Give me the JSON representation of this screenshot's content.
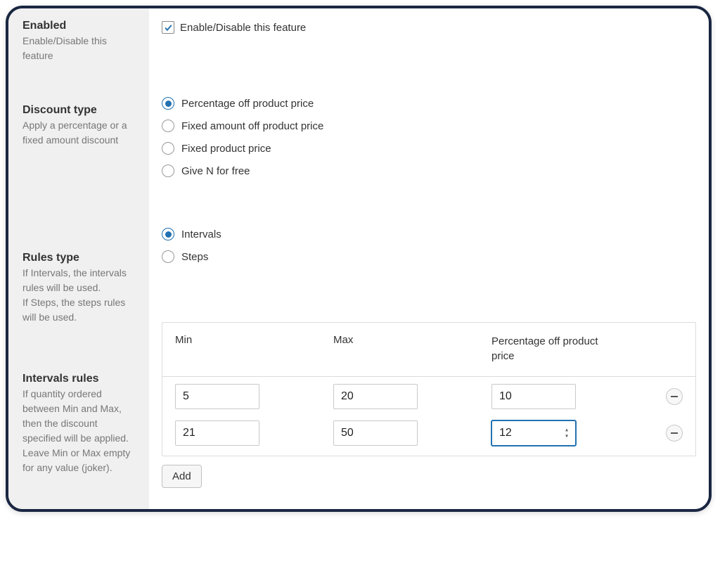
{
  "sidebar": {
    "enabled": {
      "title": "Enabled",
      "desc": "Enable/Disable this feature"
    },
    "discount": {
      "title": "Discount type",
      "desc": "Apply a percentage or a fixed amount discount"
    },
    "rules": {
      "title": "Rules type",
      "desc": "If Intervals, the intervals rules will be used.\nIf Steps, the steps rules will be used."
    },
    "intervals": {
      "title": "Intervals rules",
      "desc": "If quantity ordered between Min and Max, then the discount specified will be applied.\nLeave Min or Max empty for any value (joker)."
    }
  },
  "enabled": {
    "checked": true,
    "label": "Enable/Disable this feature"
  },
  "discount_type": {
    "options": [
      {
        "label": "Percentage off product price",
        "selected": true
      },
      {
        "label": "Fixed amount off product price",
        "selected": false
      },
      {
        "label": "Fixed product price",
        "selected": false
      },
      {
        "label": "Give N for free",
        "selected": false
      }
    ]
  },
  "rules_type": {
    "options": [
      {
        "label": "Intervals",
        "selected": true
      },
      {
        "label": "Steps",
        "selected": false
      }
    ]
  },
  "intervals_table": {
    "headers": {
      "min": "Min",
      "max": "Max",
      "discount": "Percentage off product price"
    },
    "rows": [
      {
        "min": "5",
        "max": "20",
        "discount": "10",
        "focused": false
      },
      {
        "min": "21",
        "max": "50",
        "discount": "12",
        "focused": true
      }
    ],
    "add_label": "Add"
  }
}
